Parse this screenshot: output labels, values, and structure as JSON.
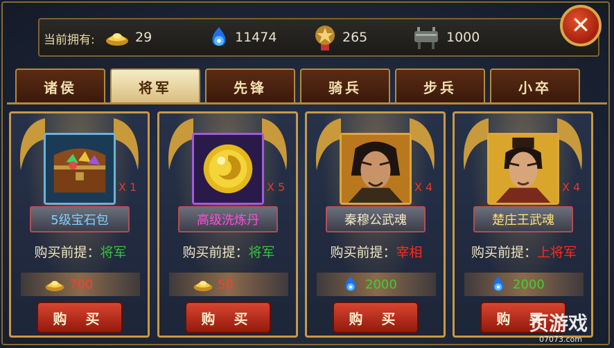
{
  "header": {
    "label": "当前拥有:",
    "resources": [
      {
        "icon": "gold-ingot-icon",
        "value": "29"
      },
      {
        "icon": "blue-soul-orb-icon",
        "value": "11474"
      },
      {
        "icon": "honor-medal-icon",
        "value": "265"
      },
      {
        "icon": "bronze-cauldron-icon",
        "value": "1000"
      }
    ],
    "close_icon": "close-x-icon"
  },
  "tabs": [
    {
      "label": "诸侯",
      "active": false
    },
    {
      "label": "将军",
      "active": true
    },
    {
      "label": "先锋",
      "active": false
    },
    {
      "label": "骑兵",
      "active": false
    },
    {
      "label": "步兵",
      "active": false
    },
    {
      "label": "小卒",
      "active": false
    }
  ],
  "cards": [
    {
      "name": "5级宝石包",
      "qty": "X 1",
      "req_label": "购买前提：",
      "req_value": "将军",
      "req_color": "#36c23a",
      "name_color": "#7fd0ff",
      "price": "700",
      "price_color": "#ff3b2a",
      "currency_icon": "gold-ingot-icon",
      "item_icon": "treasure-chest-gems-icon",
      "buy_label": "购 买"
    },
    {
      "name": "高级洗炼丹",
      "qty": "X 5",
      "req_label": "购买前提：",
      "req_value": "将军",
      "req_color": "#36c23a",
      "name_color": "#ff4bd8",
      "price": "50",
      "price_color": "#ff3b2a",
      "currency_icon": "gold-ingot-icon",
      "item_icon": "golden-pill-icon",
      "buy_label": "购 买"
    },
    {
      "name": "秦穆公武魂",
      "qty": "X 4",
      "req_label": "购买前提：",
      "req_value": "宰相",
      "req_color": "#ff2a1a",
      "name_color": "#f4e7c3",
      "price": "2000",
      "price_color": "#3bd12f",
      "currency_icon": "blue-soul-orb-icon",
      "item_icon": "warrior-portrait-icon",
      "buy_label": "购 买"
    },
    {
      "name": "楚庄王武魂",
      "qty": "X 4",
      "req_label": "购买前提：",
      "req_value": "上将军",
      "req_color": "#ff2a1a",
      "name_color": "#ffe070",
      "price": "2000",
      "price_color": "#3bd12f",
      "currency_icon": "blue-soul-orb-icon",
      "item_icon": "king-portrait-icon",
      "buy_label": "购 买"
    }
  ],
  "watermark": {
    "main": "页游戏",
    "sub": "07073.com"
  },
  "colors": {
    "gold_border": "#c79a48",
    "tab_active": "#efe0b4",
    "buy_button": "#c6301d"
  }
}
